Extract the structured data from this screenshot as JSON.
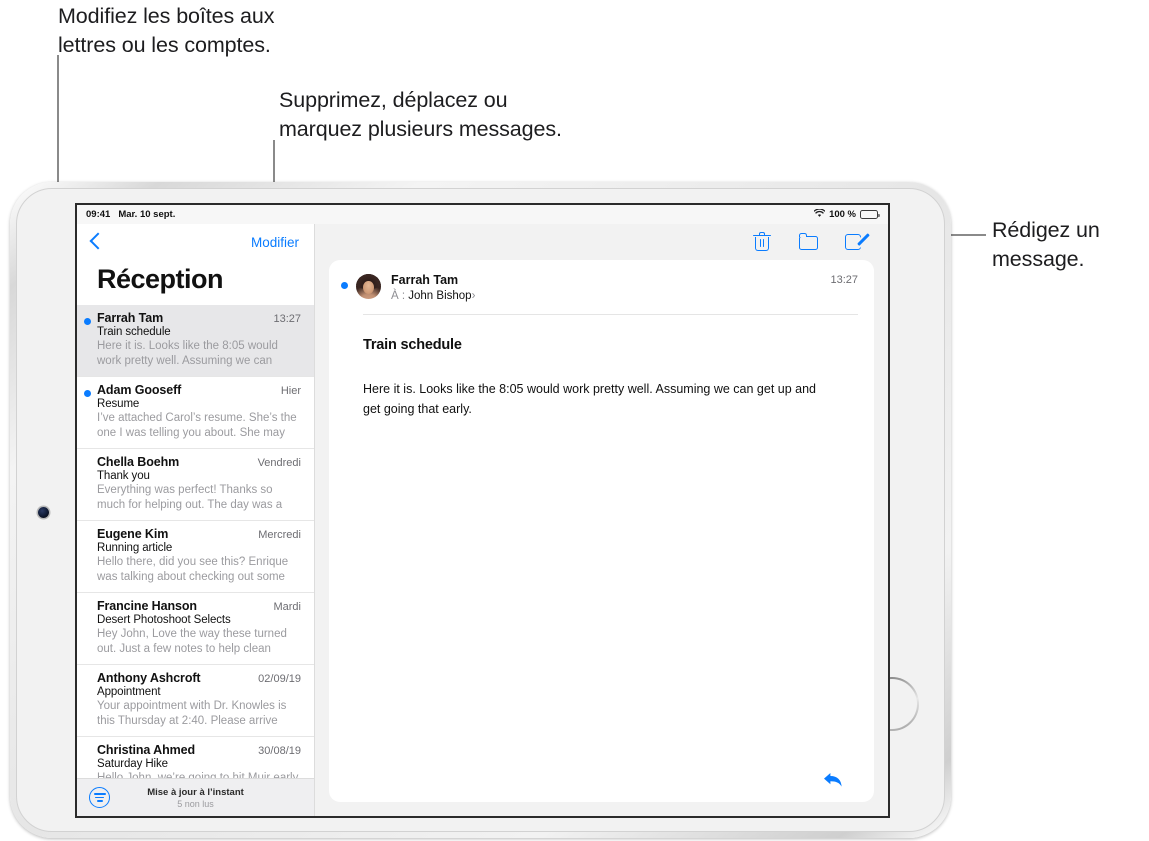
{
  "callouts": {
    "mailboxes": "Modifiez les boîtes aux\nlettres ou les comptes.",
    "manage": "Supprimez, déplacez ou\nmarquez plusieurs messages.",
    "compose": "Rédigez un\nmessage."
  },
  "status_bar": {
    "time": "09:41",
    "date": "Mar. 10 sept.",
    "battery_percent": "100 %",
    "wifi_icon": "wifi-icon",
    "battery_icon": "battery-full-icon"
  },
  "sidebar": {
    "back_icon": "chevron-left-icon",
    "edit_label": "Modifier",
    "title": "Réception",
    "messages": [
      {
        "sender": "Farrah Tam",
        "date": "13:27",
        "subject": "Train schedule",
        "preview": "Here it is. Looks like the 8:05 would work pretty well. Assuming we can get…",
        "unread": true,
        "selected": true
      },
      {
        "sender": "Adam Gooseff",
        "date": "Hier",
        "subject": "Resume",
        "preview": "I’ve attached Carol’s resume. She’s the one I was telling you about. She may n…",
        "unread": true,
        "selected": false
      },
      {
        "sender": "Chella Boehm",
        "date": "Vendredi",
        "subject": "Thank you",
        "preview": "Everything was perfect! Thanks so much for helping out. The day was a great su…",
        "unread": false,
        "selected": false
      },
      {
        "sender": "Eugene Kim",
        "date": "Mercredi",
        "subject": "Running article",
        "preview": "Hello there, did you see this? Enrique was talking about checking out some o…",
        "unread": false,
        "selected": false
      },
      {
        "sender": "Francine Hanson",
        "date": "Mardi",
        "subject": "Desert Photoshoot Selects",
        "preview": "Hey John, Love the way these turned out. Just a few notes to help clean this…",
        "unread": false,
        "selected": false
      },
      {
        "sender": "Anthony Ashcroft",
        "date": "02/09/19",
        "subject": "Appointment",
        "preview": "Your appointment with Dr. Knowles is this Thursday at 2:40. Please arrive by…",
        "unread": false,
        "selected": false
      },
      {
        "sender": "Christina Ahmed",
        "date": "30/08/19",
        "subject": "Saturday Hike",
        "preview": "Hello John, we’re going to hit Muir early",
        "unread": false,
        "selected": false
      }
    ],
    "footer": {
      "filter_icon": "filter-icon",
      "status_line1": "Mise à jour à l’instant",
      "status_line2": "5 non lus"
    }
  },
  "detail": {
    "toolbar": {
      "delete_icon": "trash-icon",
      "move_icon": "folder-icon",
      "compose_icon": "compose-icon"
    },
    "message": {
      "from": "Farrah Tam",
      "to_label": "À :",
      "to_name": "John Bishop",
      "to_chevron": "›",
      "time": "13:27",
      "subject": "Train schedule",
      "body": "Here it is. Looks like the 8:05 would work pretty well. Assuming we can get up and get going that early.",
      "avatar": "contact-avatar",
      "reply_icon": "reply-arrow-icon"
    }
  },
  "device": {
    "camera": "front-camera",
    "home_button": "home-button"
  },
  "colors": {
    "accent": "#0a7cff",
    "selected_row": "#e7e7e9",
    "preview_text": "#9b9b9f",
    "callout_line": "#8a8a8a"
  }
}
